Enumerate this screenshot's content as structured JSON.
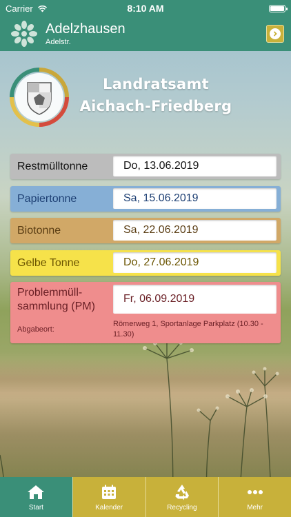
{
  "status_bar": {
    "carrier": "Carrier",
    "time": "8:10 AM"
  },
  "header": {
    "title": "Adelzhausen",
    "subtitle": "Adelstr."
  },
  "authority": {
    "line1": "Landratsamt",
    "line2": "Aichach-Friedberg"
  },
  "schedule": [
    {
      "label": "Restmülltonne",
      "date": "Do, 13.06.2019"
    },
    {
      "label": "Papiertonne",
      "date": "Sa, 15.06.2019"
    },
    {
      "label": "Biotonne",
      "date": "Sa, 22.06.2019"
    },
    {
      "label": "Gelbe Tonne",
      "date": "Do, 27.06.2019"
    }
  ],
  "problem": {
    "label": "Problemmüll-sammlung (PM)",
    "date": "Fr,   06.09.2019",
    "drop_label": "Abgabeort:",
    "drop_address": "Römerweg 1, Sportanlage Parkplatz (10.30 - 11.30)"
  },
  "tabs": [
    {
      "label": "Start",
      "icon": "home-icon",
      "active": true
    },
    {
      "label": "Kalender",
      "icon": "calendar-icon",
      "active": false
    },
    {
      "label": "Recycling",
      "icon": "recycling-icon",
      "active": false
    },
    {
      "label": "Mehr",
      "icon": "more-icon",
      "active": false
    }
  ],
  "colors": {
    "header": "#3a8f78",
    "tabbar": "#c8b13a",
    "restmuell": "#bcbcbc",
    "papier": "#86afd6",
    "bio": "#d1a867",
    "gelb": "#f6e24a",
    "problem": "#ef8d8d"
  }
}
